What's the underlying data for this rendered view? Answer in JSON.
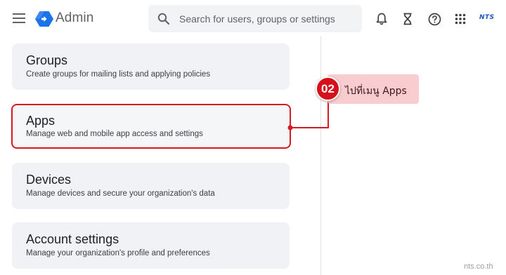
{
  "header": {
    "brand_name": "Admin",
    "search_placeholder": "Search for users, groups or settings",
    "search_value": "",
    "logo_text": "NTS",
    "icons": [
      "menu-icon",
      "google-admin-logo",
      "search-icon",
      "bell-icon",
      "hourglass-icon",
      "help-icon",
      "apps-grid-icon"
    ]
  },
  "cards": [
    {
      "title": "Groups",
      "description": "Create groups for mailing lists and applying policies"
    },
    {
      "title": "Apps",
      "description": "Manage web and mobile app access and settings",
      "highlighted": true
    },
    {
      "title": "Devices",
      "description": "Manage devices and secure your organization's data"
    },
    {
      "title": "Account settings",
      "description": "Manage your organization's profile and preferences"
    }
  ],
  "callout": {
    "step": "02",
    "text": "ไปที่เมนู Apps",
    "badge_color": "#d60f1a",
    "pill_color": "#f9cdd0"
  },
  "watermark": "nts.co.th",
  "colors": {
    "highlight_border": "#d71920",
    "card_background": "#f0f2f5",
    "brand_blue": "#1a73e8"
  }
}
